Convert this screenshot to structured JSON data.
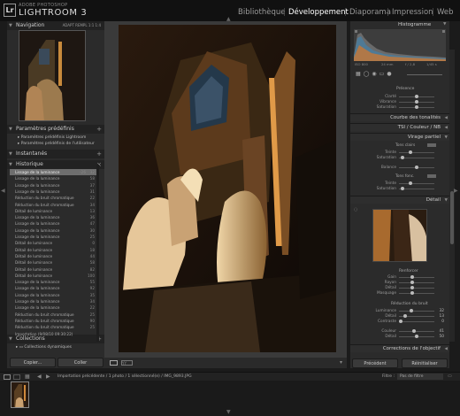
{
  "brand": {
    "sub": "ADOBE PHOTOSHOP",
    "name": "LIGHTROOM 3",
    "logo": "Lr"
  },
  "modules": [
    "Bibliothèque",
    "Développement",
    "Diaporama",
    "Impression",
    "Web"
  ],
  "left": {
    "navigator": {
      "title": "Navigation",
      "opts": "ADAPT  REMPL  1:1  1:4"
    },
    "presets": {
      "title": "Paramètres prédéfinis",
      "items": [
        "Paramètres prédéfinis Lightroom",
        "Paramètres prédéfinis de l'utilisateur"
      ]
    },
    "snapshots": {
      "title": "Instantanés"
    },
    "history": {
      "title": "Historique",
      "rows": [
        {
          "label": "Lissage de la luminance",
          "v1": "-26",
          "v2": "32"
        },
        {
          "label": "Lissage de la luminance",
          "v1": "",
          "v2": "58"
        },
        {
          "label": "Lissage de la luminance",
          "v1": "",
          "v2": "37"
        },
        {
          "label": "Lissage de la luminance",
          "v1": "",
          "v2": "31"
        },
        {
          "label": "Réduction du bruit chromatique",
          "v1": "",
          "v2": "22"
        },
        {
          "label": "Réduction du bruit chromatique",
          "v1": "",
          "v2": "34"
        },
        {
          "label": "Détail de luminance",
          "v1": "",
          "v2": "13"
        },
        {
          "label": "Lissage de la luminance",
          "v1": "",
          "v2": "36"
        },
        {
          "label": "Lissage de la luminance",
          "v1": "",
          "v2": "47"
        },
        {
          "label": "Lissage de la luminance",
          "v1": "",
          "v2": "30"
        },
        {
          "label": "Lissage de la luminance",
          "v1": "",
          "v2": "25"
        },
        {
          "label": "Détail de luminance",
          "v1": "",
          "v2": "0"
        },
        {
          "label": "Détail de luminance",
          "v1": "",
          "v2": "18"
        },
        {
          "label": "Détail de luminance",
          "v1": "",
          "v2": "44"
        },
        {
          "label": "Détail de luminance",
          "v1": "",
          "v2": "58"
        },
        {
          "label": "Détail de luminance",
          "v1": "",
          "v2": "82"
        },
        {
          "label": "Détail de luminance",
          "v1": "",
          "v2": "100"
        },
        {
          "label": "Lissage de la luminance",
          "v1": "",
          "v2": "55"
        },
        {
          "label": "Lissage de la luminance",
          "v1": "",
          "v2": "92"
        },
        {
          "label": "Lissage de la luminance",
          "v1": "",
          "v2": "35"
        },
        {
          "label": "Lissage de la luminance",
          "v1": "",
          "v2": "34"
        },
        {
          "label": "Lissage de la luminance",
          "v1": "",
          "v2": "22"
        },
        {
          "label": "Réduction du bruit chromatique",
          "v1": "",
          "v2": "25"
        },
        {
          "label": "Réduction du bruit chromatique",
          "v1": "",
          "v2": "90"
        },
        {
          "label": "Réduction du bruit chromatique",
          "v1": "",
          "v2": "25"
        },
        {
          "label": "Importation (9/08/10 09:30:22)",
          "v1": "",
          "v2": ""
        }
      ]
    },
    "collections": {
      "title": "Collections",
      "item": "Collections dynamiques"
    },
    "copy_label": "Copier...",
    "paste_label": "Coller"
  },
  "right": {
    "histogram": {
      "title": "Histogramme",
      "info": [
        "ISO 800",
        "24 mm",
        "f / 2,8",
        "1/45 s"
      ]
    },
    "presence": {
      "title": "Présence",
      "sliders": [
        "Clarté",
        "Vibrance",
        "Saturation"
      ]
    },
    "tone_curve": {
      "title": "Courbe des tonalités"
    },
    "hsl": {
      "label": "TSI / Couleur / NB"
    },
    "split_toning": {
      "title": "Virage partiel",
      "highlights": "Tons clairs",
      "shadows": "Tons fonc.",
      "balance": "Balance",
      "hue": "Teinte",
      "sat": "Saturation"
    },
    "detail": {
      "title": "Détail"
    },
    "sharpening": {
      "title": "Renforcer",
      "sliders": [
        "Gain",
        "Rayon",
        "Détail",
        "Masquage"
      ]
    },
    "noise": {
      "title": "Réduction du bruit",
      "luminance": {
        "label": "Luminance",
        "value": "32"
      },
      "detail": {
        "label": "Détail",
        "value": "13"
      },
      "contrast": {
        "label": "Contraste",
        "value": "0"
      },
      "color": {
        "label": "Couleur",
        "value": "41"
      },
      "color_detail": {
        "label": "Détail",
        "value": "50"
      }
    },
    "lens": {
      "title": "Corrections de l'objectif"
    },
    "previous_label": "Précédent",
    "reset_label": "Réinitialiser"
  },
  "filmstrip": {
    "path": "Importation précédente / 1 photo / 1 sélectionné(e) / IMG_9893.JPG",
    "filter_label": "Filtre :",
    "filter_value": "Pas de filtre",
    "page1": "1",
    "page2": "2"
  },
  "colors": {
    "accent": "#d8d8d8",
    "selected_row": "#6e6e6e",
    "panel": "#2b2b2b"
  }
}
